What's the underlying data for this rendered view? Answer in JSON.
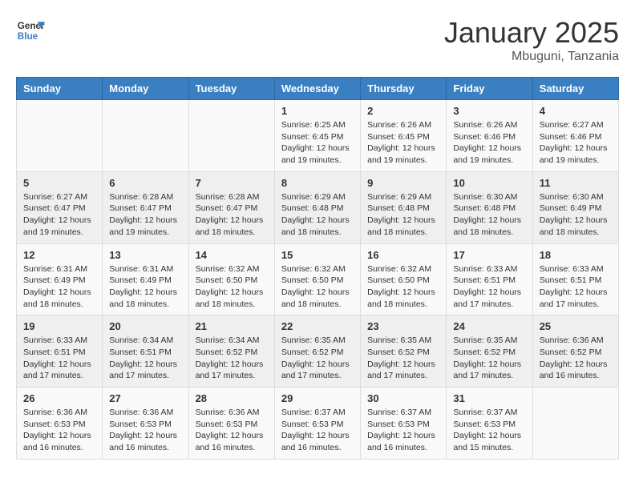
{
  "header": {
    "logo_general": "General",
    "logo_blue": "Blue",
    "month_title": "January 2025",
    "location": "Mbuguni, Tanzania"
  },
  "days_of_week": [
    "Sunday",
    "Monday",
    "Tuesday",
    "Wednesday",
    "Thursday",
    "Friday",
    "Saturday"
  ],
  "weeks": [
    [
      {
        "day": "",
        "info": ""
      },
      {
        "day": "",
        "info": ""
      },
      {
        "day": "",
        "info": ""
      },
      {
        "day": "1",
        "info": "Sunrise: 6:25 AM\nSunset: 6:45 PM\nDaylight: 12 hours and 19 minutes."
      },
      {
        "day": "2",
        "info": "Sunrise: 6:26 AM\nSunset: 6:45 PM\nDaylight: 12 hours and 19 minutes."
      },
      {
        "day": "3",
        "info": "Sunrise: 6:26 AM\nSunset: 6:46 PM\nDaylight: 12 hours and 19 minutes."
      },
      {
        "day": "4",
        "info": "Sunrise: 6:27 AM\nSunset: 6:46 PM\nDaylight: 12 hours and 19 minutes."
      }
    ],
    [
      {
        "day": "5",
        "info": "Sunrise: 6:27 AM\nSunset: 6:47 PM\nDaylight: 12 hours and 19 minutes."
      },
      {
        "day": "6",
        "info": "Sunrise: 6:28 AM\nSunset: 6:47 PM\nDaylight: 12 hours and 19 minutes."
      },
      {
        "day": "7",
        "info": "Sunrise: 6:28 AM\nSunset: 6:47 PM\nDaylight: 12 hours and 18 minutes."
      },
      {
        "day": "8",
        "info": "Sunrise: 6:29 AM\nSunset: 6:48 PM\nDaylight: 12 hours and 18 minutes."
      },
      {
        "day": "9",
        "info": "Sunrise: 6:29 AM\nSunset: 6:48 PM\nDaylight: 12 hours and 18 minutes."
      },
      {
        "day": "10",
        "info": "Sunrise: 6:30 AM\nSunset: 6:48 PM\nDaylight: 12 hours and 18 minutes."
      },
      {
        "day": "11",
        "info": "Sunrise: 6:30 AM\nSunset: 6:49 PM\nDaylight: 12 hours and 18 minutes."
      }
    ],
    [
      {
        "day": "12",
        "info": "Sunrise: 6:31 AM\nSunset: 6:49 PM\nDaylight: 12 hours and 18 minutes."
      },
      {
        "day": "13",
        "info": "Sunrise: 6:31 AM\nSunset: 6:49 PM\nDaylight: 12 hours and 18 minutes."
      },
      {
        "day": "14",
        "info": "Sunrise: 6:32 AM\nSunset: 6:50 PM\nDaylight: 12 hours and 18 minutes."
      },
      {
        "day": "15",
        "info": "Sunrise: 6:32 AM\nSunset: 6:50 PM\nDaylight: 12 hours and 18 minutes."
      },
      {
        "day": "16",
        "info": "Sunrise: 6:32 AM\nSunset: 6:50 PM\nDaylight: 12 hours and 18 minutes."
      },
      {
        "day": "17",
        "info": "Sunrise: 6:33 AM\nSunset: 6:51 PM\nDaylight: 12 hours and 17 minutes."
      },
      {
        "day": "18",
        "info": "Sunrise: 6:33 AM\nSunset: 6:51 PM\nDaylight: 12 hours and 17 minutes."
      }
    ],
    [
      {
        "day": "19",
        "info": "Sunrise: 6:33 AM\nSunset: 6:51 PM\nDaylight: 12 hours and 17 minutes."
      },
      {
        "day": "20",
        "info": "Sunrise: 6:34 AM\nSunset: 6:51 PM\nDaylight: 12 hours and 17 minutes."
      },
      {
        "day": "21",
        "info": "Sunrise: 6:34 AM\nSunset: 6:52 PM\nDaylight: 12 hours and 17 minutes."
      },
      {
        "day": "22",
        "info": "Sunrise: 6:35 AM\nSunset: 6:52 PM\nDaylight: 12 hours and 17 minutes."
      },
      {
        "day": "23",
        "info": "Sunrise: 6:35 AM\nSunset: 6:52 PM\nDaylight: 12 hours and 17 minutes."
      },
      {
        "day": "24",
        "info": "Sunrise: 6:35 AM\nSunset: 6:52 PM\nDaylight: 12 hours and 17 minutes."
      },
      {
        "day": "25",
        "info": "Sunrise: 6:36 AM\nSunset: 6:52 PM\nDaylight: 12 hours and 16 minutes."
      }
    ],
    [
      {
        "day": "26",
        "info": "Sunrise: 6:36 AM\nSunset: 6:53 PM\nDaylight: 12 hours and 16 minutes."
      },
      {
        "day": "27",
        "info": "Sunrise: 6:36 AM\nSunset: 6:53 PM\nDaylight: 12 hours and 16 minutes."
      },
      {
        "day": "28",
        "info": "Sunrise: 6:36 AM\nSunset: 6:53 PM\nDaylight: 12 hours and 16 minutes."
      },
      {
        "day": "29",
        "info": "Sunrise: 6:37 AM\nSunset: 6:53 PM\nDaylight: 12 hours and 16 minutes."
      },
      {
        "day": "30",
        "info": "Sunrise: 6:37 AM\nSunset: 6:53 PM\nDaylight: 12 hours and 16 minutes."
      },
      {
        "day": "31",
        "info": "Sunrise: 6:37 AM\nSunset: 6:53 PM\nDaylight: 12 hours and 15 minutes."
      },
      {
        "day": "",
        "info": ""
      }
    ]
  ]
}
